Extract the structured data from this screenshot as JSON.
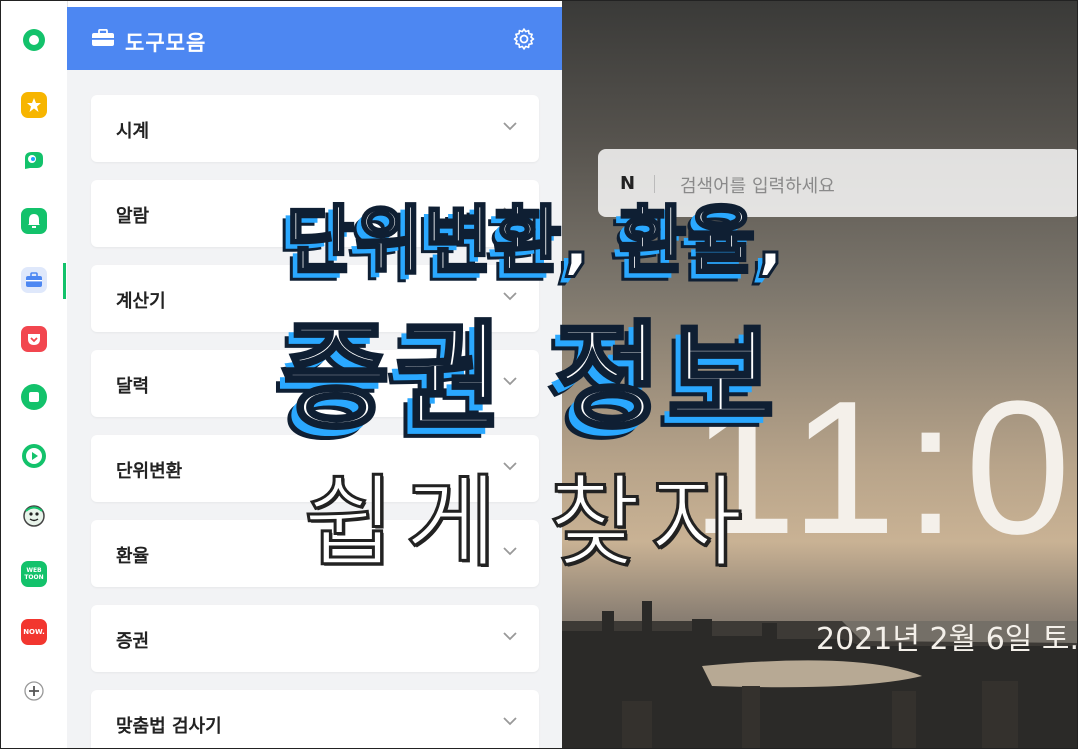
{
  "rail": {
    "items": [
      {
        "icon": "naver-green-circle-icon",
        "color": "#13c26b"
      },
      {
        "icon": "star-icon",
        "color": "#f7b500"
      },
      {
        "icon": "papago-icon",
        "color": "#1aa3ff"
      },
      {
        "icon": "bell-icon",
        "color": "#13c26b"
      },
      {
        "icon": "briefcase-icon",
        "color": "#4d87f2"
      },
      {
        "icon": "pocket-icon",
        "color": "#f2464f"
      },
      {
        "icon": "square-icon",
        "color": "#13c26b"
      },
      {
        "icon": "play-icon",
        "color": "#13c26b"
      },
      {
        "icon": "character-icon",
        "color": "#555555"
      },
      {
        "icon": "webtoon-icon",
        "color": "#13c26b"
      },
      {
        "icon": "now-icon",
        "color": "#f2362f"
      },
      {
        "icon": "plus-icon",
        "color": "#555555"
      }
    ],
    "webtoon_text": "WEB TOON",
    "now_text": "NOW."
  },
  "panel": {
    "title": "도구모음",
    "items": [
      {
        "label": "시계"
      },
      {
        "label": "알람"
      },
      {
        "label": "계산기"
      },
      {
        "label": "달력"
      },
      {
        "label": "단위변환"
      },
      {
        "label": "환율"
      },
      {
        "label": "증권"
      },
      {
        "label": "맞춤법 검사기"
      }
    ]
  },
  "search": {
    "logo": "N",
    "placeholder": "검색어를 입력하세요"
  },
  "clock": {
    "time": "11:0",
    "date": "2021년 2월 6일 토."
  },
  "overlay": {
    "line1": "단위변환, 환율,",
    "line2": "증권 정보",
    "line3": "쉽게 찾자"
  },
  "colors": {
    "header_blue": "#4d87f2",
    "accent_green": "#13c26b",
    "overlay_shadow": "#2aa8ff"
  }
}
